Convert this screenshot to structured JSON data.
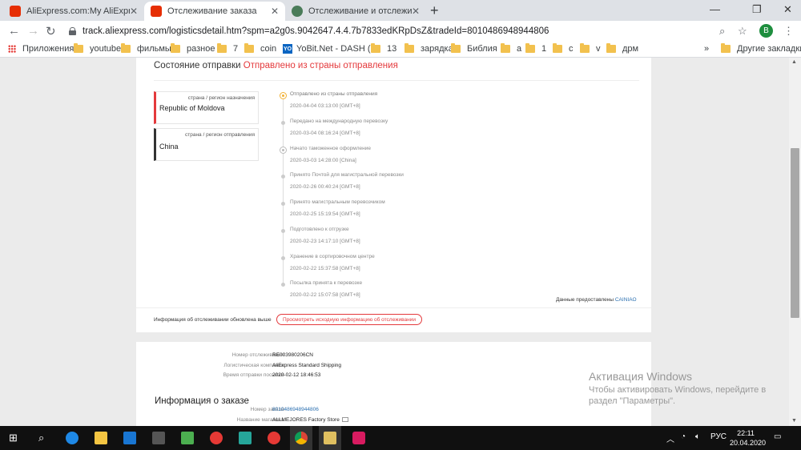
{
  "browser": {
    "tabs": [
      {
        "title": "AliExpress.com:My AliExpress",
        "icon": "aliexpress-icon"
      },
      {
        "title": "Отслеживание заказа",
        "icon": "aliexpress-icon",
        "active": true
      },
      {
        "title": "Отслеживание и отслеживание",
        "icon": "globe-icon"
      }
    ],
    "new_tab": "+",
    "url": "track.aliexpress.com/logisticsdetail.htm?spm=a2g0s.9042647.4.4.7b7833edKRpDsZ&tradeId=8010486948944806",
    "profile_initial": "B",
    "bookmarks": [
      {
        "label": "Приложения",
        "icon": "apps-icon"
      },
      {
        "label": "youtube",
        "icon": "folder-icon"
      },
      {
        "label": "фильмы",
        "icon": "folder-icon"
      },
      {
        "label": "разное",
        "icon": "folder-icon"
      },
      {
        "label": "7",
        "icon": "folder-icon"
      },
      {
        "label": "coin",
        "icon": "folder-icon"
      },
      {
        "label": "YoBit.Net - DASH (...",
        "icon": "yobit-icon"
      },
      {
        "label": "13",
        "icon": "folder-icon"
      },
      {
        "label": "зарядка",
        "icon": "folder-icon"
      },
      {
        "label": "Библия",
        "icon": "folder-icon"
      },
      {
        "label": "а",
        "icon": "folder-icon"
      },
      {
        "label": "1",
        "icon": "folder-icon"
      },
      {
        "label": "с",
        "icon": "folder-icon"
      },
      {
        "label": "v",
        "icon": "folder-icon"
      },
      {
        "label": "дрм",
        "icon": "folder-icon"
      }
    ],
    "bookmarks_overflow": "»",
    "other_bookmarks": "Другие закладки"
  },
  "tracking": {
    "status_label": "Состояние отправки",
    "status_value": "Отправлено из страны отправления",
    "destination_label": "страна / регион назначения",
    "destination_value": "Republic of Moldova",
    "origin_label": "страна / регион отправления",
    "origin_value": "China",
    "events": [
      {
        "title": "Отправлено из страны отправления",
        "date": "2020-04-04 03:13:00 [GMT+8]"
      },
      {
        "title": "Передано на международную перевозку",
        "date": "2020-03-04 08:16:24 [GMT+8]"
      },
      {
        "title": "Начато таможенное оформление",
        "date": "2020-03-03 14:28:00 [China]"
      },
      {
        "title": "Принято Почтой для магистральной перевозки",
        "date": "2020-02-26 00:40:24 [GMT+8]"
      },
      {
        "title": "Принято магистральным перевозчиком",
        "date": "2020-02-25 15:19:54 [GMT+8]"
      },
      {
        "title": "Подготовлено к отгрузке",
        "date": "2020-02-23 14:17:10 [GMT+8]"
      },
      {
        "title": "Хранение в сортировочном центре",
        "date": "2020-02-22 15:37:58 [GMT+8]"
      },
      {
        "title": "Посылка принята к перевозке",
        "date": "2020-02-22 15:07:58 [GMT+8]"
      }
    ],
    "provided_by_label": "Данные предоставлены",
    "provided_by_value": "CAINIAO",
    "updated_text": "Информация об отслеживании обновлена выше",
    "view_original_button": "Просмотреть исходную информацию об отслеживании"
  },
  "shipment": {
    "tracking_number_label": "Номер отслеживания:",
    "tracking_number": "RE003980206CN",
    "carrier_label": "Логистическая компания:",
    "carrier": "AliExpress Standard Shipping",
    "sent_time_label": "Время отправки посылки:",
    "sent_time": "2020-02-12 18:46:53"
  },
  "order": {
    "title": "Информация о заказе",
    "order_number_label": "Номер заказа:",
    "order_number": "8010486948944806",
    "store_label": "Название магазина:",
    "store": "ALLMEJORES Factory Store"
  },
  "watermark": {
    "title": "Активация Windows",
    "subtitle": "Чтобы активировать Windows, перейдите в раздел \"Параметры\"."
  },
  "taskbar": {
    "language": "РУС",
    "time": "22:11",
    "date": "20.04.2020"
  },
  "colors": {
    "accent_red": "#e4393c",
    "link_blue": "#2a6fb0",
    "timeline_orange": "#f2b134"
  }
}
